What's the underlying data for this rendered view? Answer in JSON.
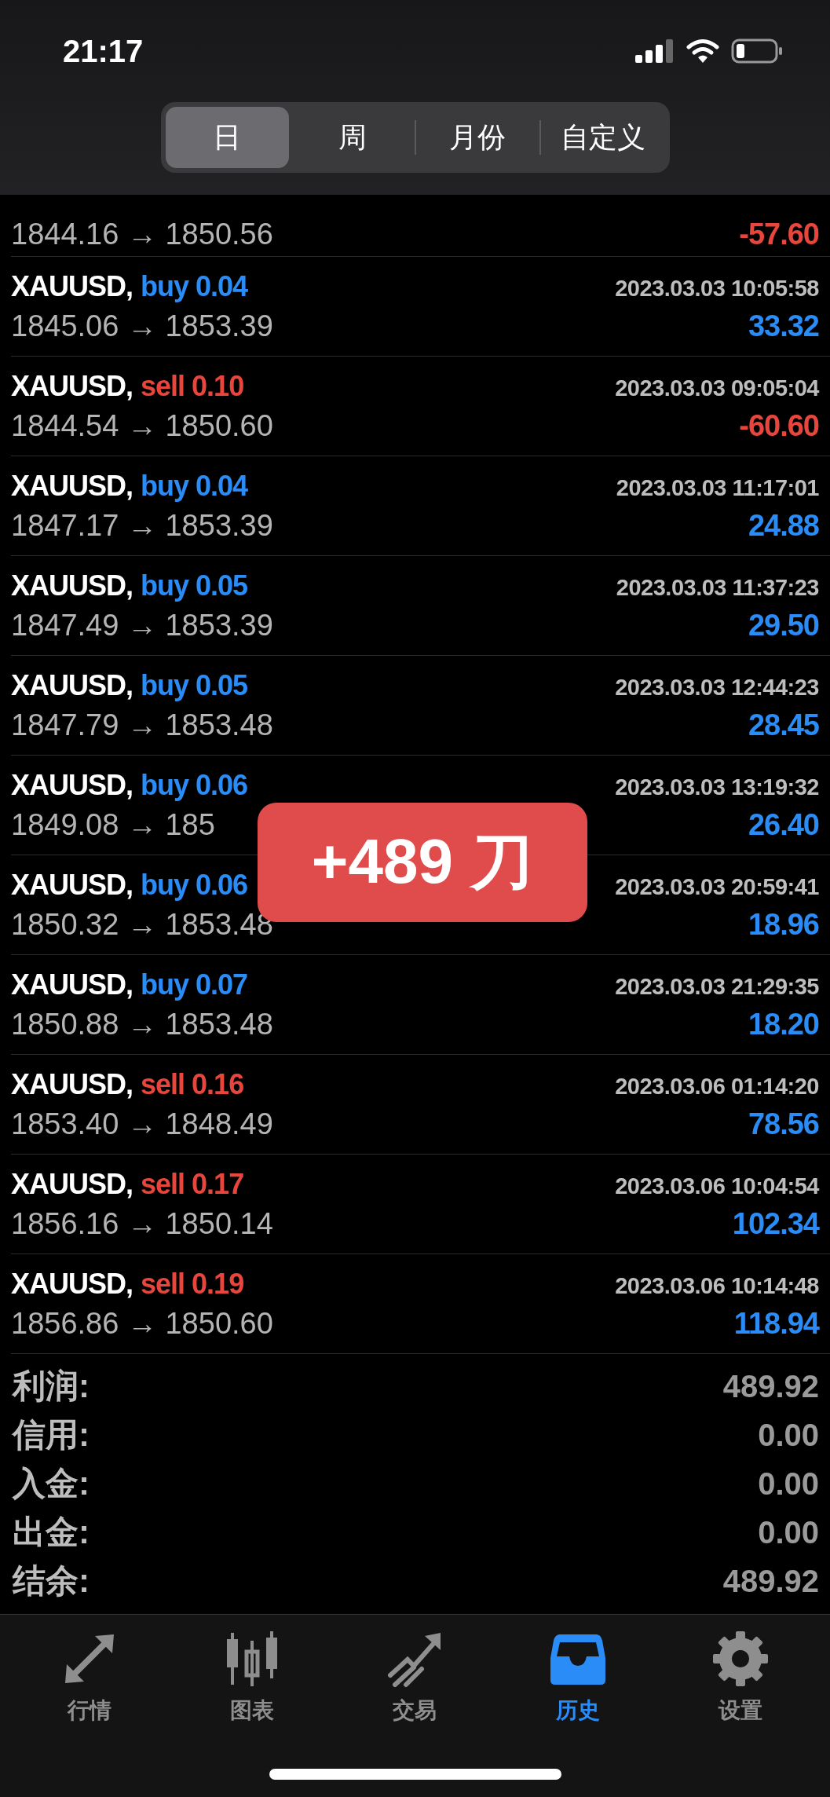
{
  "status_bar": {
    "time": "21:17"
  },
  "period_tabs": [
    {
      "label": "日",
      "selected": true
    },
    {
      "label": "周",
      "selected": false
    },
    {
      "label": "月份",
      "selected": false
    },
    {
      "label": "自定义",
      "selected": false
    }
  ],
  "partial_row": {
    "prices": "1844.16 → 1850.56",
    "profit": {
      "text": "-57.60",
      "color": "#e8453c"
    }
  },
  "deals": [
    {
      "symbol": "XAUUSD,",
      "order": {
        "text": "buy 0.04",
        "color": "#2a8cf7"
      },
      "time": "2023.03.03 10:05:58",
      "prices": "1845.06 → 1853.39",
      "profit": {
        "text": "33.32",
        "color": "#2a8cf7"
      }
    },
    {
      "symbol": "XAUUSD,",
      "order": {
        "text": "sell 0.10",
        "color": "#e8453c"
      },
      "time": "2023.03.03 09:05:04",
      "prices": "1844.54 → 1850.60",
      "profit": {
        "text": "-60.60",
        "color": "#e8453c"
      }
    },
    {
      "symbol": "XAUUSD,",
      "order": {
        "text": "buy 0.04",
        "color": "#2a8cf7"
      },
      "time": "2023.03.03 11:17:01",
      "prices": "1847.17 → 1853.39",
      "profit": {
        "text": "24.88",
        "color": "#2a8cf7"
      }
    },
    {
      "symbol": "XAUUSD,",
      "order": {
        "text": "buy 0.05",
        "color": "#2a8cf7"
      },
      "time": "2023.03.03 11:37:23",
      "prices": "1847.49 → 1853.39",
      "profit": {
        "text": "29.50",
        "color": "#2a8cf7"
      }
    },
    {
      "symbol": "XAUUSD,",
      "order": {
        "text": "buy 0.05",
        "color": "#2a8cf7"
      },
      "time": "2023.03.03 12:44:23",
      "prices": "1847.79 → 1853.48",
      "profit": {
        "text": "28.45",
        "color": "#2a8cf7"
      }
    },
    {
      "symbol": "XAUUSD,",
      "order": {
        "text": "buy 0.06",
        "color": "#2a8cf7"
      },
      "time": "2023.03.03 13:19:32",
      "prices": "1849.08 → 185",
      "profit": {
        "text": "26.40",
        "color": "#2a8cf7"
      }
    },
    {
      "symbol": "XAUUSD,",
      "order": {
        "text": "buy 0.06",
        "color": "#2a8cf7"
      },
      "time": "2023.03.03 20:59:41",
      "prices": "1850.32 → 1853.48",
      "profit": {
        "text": "18.96",
        "color": "#2a8cf7"
      }
    },
    {
      "symbol": "XAUUSD,",
      "order": {
        "text": "buy 0.07",
        "color": "#2a8cf7"
      },
      "time": "2023.03.03 21:29:35",
      "prices": "1850.88 → 1853.48",
      "profit": {
        "text": "18.20",
        "color": "#2a8cf7"
      }
    },
    {
      "symbol": "XAUUSD,",
      "order": {
        "text": "sell 0.16",
        "color": "#e8453c"
      },
      "time": "2023.03.06 01:14:20",
      "prices": "1853.40 → 1848.49",
      "profit": {
        "text": "78.56",
        "color": "#2a8cf7"
      }
    },
    {
      "symbol": "XAUUSD,",
      "order": {
        "text": "sell 0.17",
        "color": "#e8453c"
      },
      "time": "2023.03.06 10:04:54",
      "prices": "1856.16 → 1850.14",
      "profit": {
        "text": "102.34",
        "color": "#2a8cf7"
      }
    },
    {
      "symbol": "XAUUSD,",
      "order": {
        "text": "sell 0.19",
        "color": "#e8453c"
      },
      "time": "2023.03.06 10:14:48",
      "prices": "1856.86 → 1850.60",
      "profit": {
        "text": "118.94",
        "color": "#2a8cf7"
      }
    }
  ],
  "summary": [
    {
      "label": "利润:",
      "value": "489.92"
    },
    {
      "label": "信用:",
      "value": "0.00"
    },
    {
      "label": "入金:",
      "value": "0.00"
    },
    {
      "label": "出金:",
      "value": "0.00"
    },
    {
      "label": "结余:",
      "value": "489.92"
    }
  ],
  "overlay_badge": "+489 刀",
  "bottom_tabs": [
    {
      "kind": "quotes",
      "label": "行情",
      "selected": false
    },
    {
      "kind": "chart",
      "label": "图表",
      "selected": false
    },
    {
      "kind": "trade",
      "label": "交易",
      "selected": false
    },
    {
      "kind": "history",
      "label": "历史",
      "selected": true
    },
    {
      "kind": "settings",
      "label": "设置",
      "selected": false
    }
  ]
}
